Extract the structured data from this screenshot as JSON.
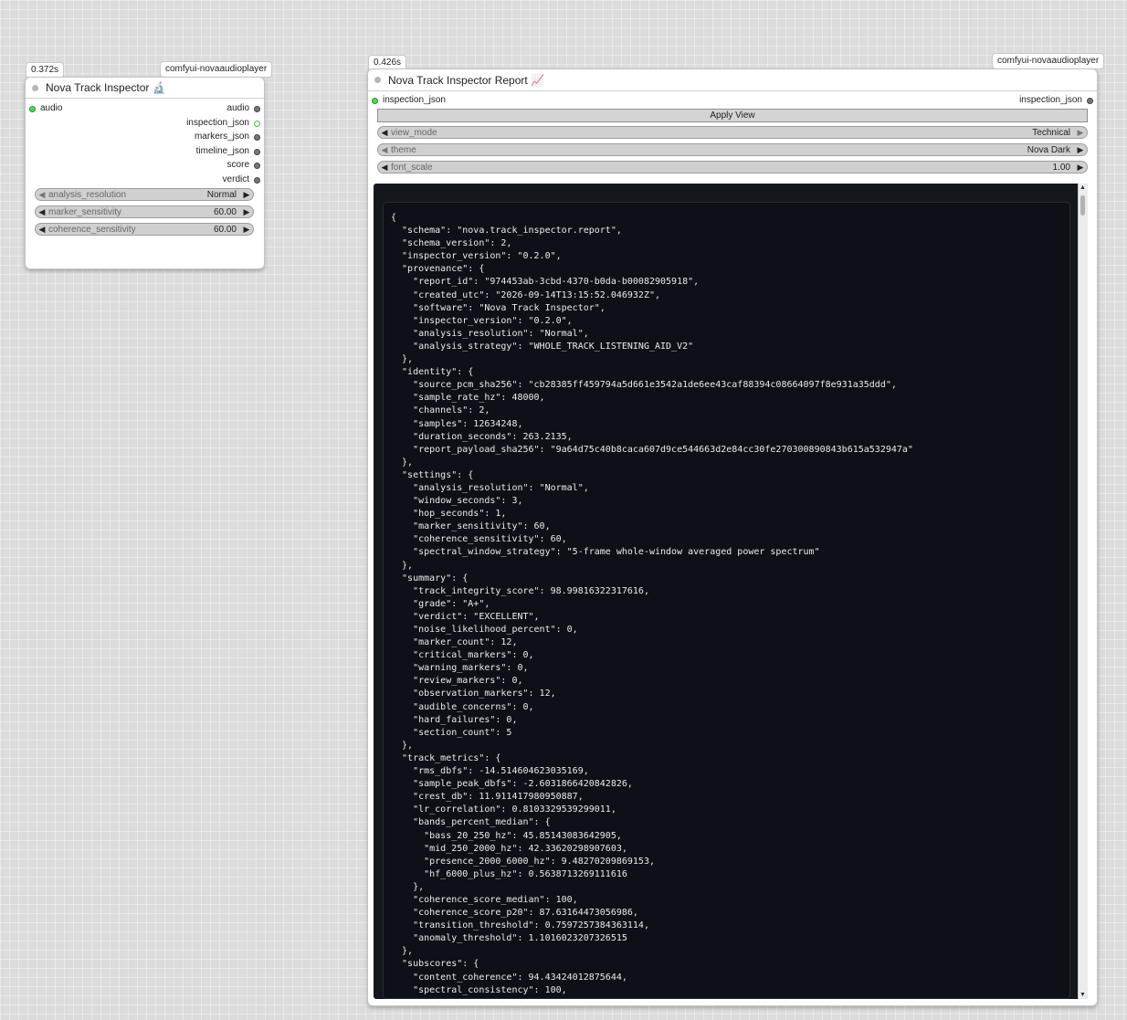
{
  "node1": {
    "time": "0.372s",
    "pack": "comfyui-novaaudioplayer",
    "title": "Nova Track Inspector 🔬",
    "input": "audio",
    "outputs": [
      "audio",
      "inspection_json",
      "markers_json",
      "timeline_json",
      "score",
      "verdict"
    ],
    "widgets": [
      {
        "name": "analysis_resolution",
        "value": "Normal"
      },
      {
        "name": "marker_sensitivity",
        "value": "60.00"
      },
      {
        "name": "coherence_sensitivity",
        "value": "60.00"
      }
    ]
  },
  "node2": {
    "time": "0.426s",
    "pack": "comfyui-novaaudioplayer",
    "title": "Nova Track Inspector Report 📈",
    "input": "inspection_json",
    "output": "inspection_json",
    "apply_label": "Apply View",
    "widgets": [
      {
        "name": "view_mode",
        "value": "Technical"
      },
      {
        "name": "theme",
        "value": "Nova Dark"
      },
      {
        "name": "font_scale",
        "value": "1.00"
      }
    ],
    "report_text": "{\n  \"schema\": \"nova.track_inspector.report\",\n  \"schema_version\": 2,\n  \"inspector_version\": \"0.2.0\",\n  \"provenance\": {\n    \"report_id\": \"974453ab-3cbd-4370-b0da-b00082905918\",\n    \"created_utc\": \"2026-09-14T13:15:52.046932Z\",\n    \"software\": \"Nova Track Inspector\",\n    \"inspector_version\": \"0.2.0\",\n    \"analysis_resolution\": \"Normal\",\n    \"analysis_strategy\": \"WHOLE_TRACK_LISTENING_AID_V2\"\n  },\n  \"identity\": {\n    \"source_pcm_sha256\": \"cb28385ff459794a5d661e3542a1de6ee43caf88394c08664097f8e931a35ddd\",\n    \"sample_rate_hz\": 48000,\n    \"channels\": 2,\n    \"samples\": 12634248,\n    \"duration_seconds\": 263.2135,\n    \"report_payload_sha256\": \"9a64d75c40b8caca607d9ce544663d2e84cc30fe270300890843b615a532947a\"\n  },\n  \"settings\": {\n    \"analysis_resolution\": \"Normal\",\n    \"window_seconds\": 3,\n    \"hop_seconds\": 1,\n    \"marker_sensitivity\": 60,\n    \"coherence_sensitivity\": 60,\n    \"spectral_window_strategy\": \"5-frame whole-window averaged power spectrum\"\n  },\n  \"summary\": {\n    \"track_integrity_score\": 98.99816322317616,\n    \"grade\": \"A+\",\n    \"verdict\": \"EXCELLENT\",\n    \"noise_likelihood_percent\": 0,\n    \"marker_count\": 12,\n    \"critical_markers\": 0,\n    \"warning_markers\": 0,\n    \"review_markers\": 0,\n    \"observation_markers\": 12,\n    \"audible_concerns\": 0,\n    \"hard_failures\": 0,\n    \"section_count\": 5\n  },\n  \"track_metrics\": {\n    \"rms_dbfs\": -14.514604623035169,\n    \"sample_peak_dbfs\": -2.6031866420842826,\n    \"crest_db\": 11.911417980950887,\n    \"lr_correlation\": 0.8103329539299011,\n    \"bands_percent_median\": {\n      \"bass_20_250_hz\": 45.85143083642905,\n      \"mid_250_2000_hz\": 42.33620298907603,\n      \"presence_2000_6000_hz\": 9.48270209869153,\n      \"hf_6000_plus_hz\": 0.5638713269111616\n    },\n    \"coherence_score_median\": 100,\n    \"coherence_score_p20\": 87.63164473056986,\n    \"transition_threshold\": 0.7597257384363114,\n    \"anomaly_threshold\": 1.1016023207326515\n  },\n  \"subscores\": {\n    \"content_coherence\": 94.43424012875644,\n    \"spectral_consistency\": 100,"
  }
}
